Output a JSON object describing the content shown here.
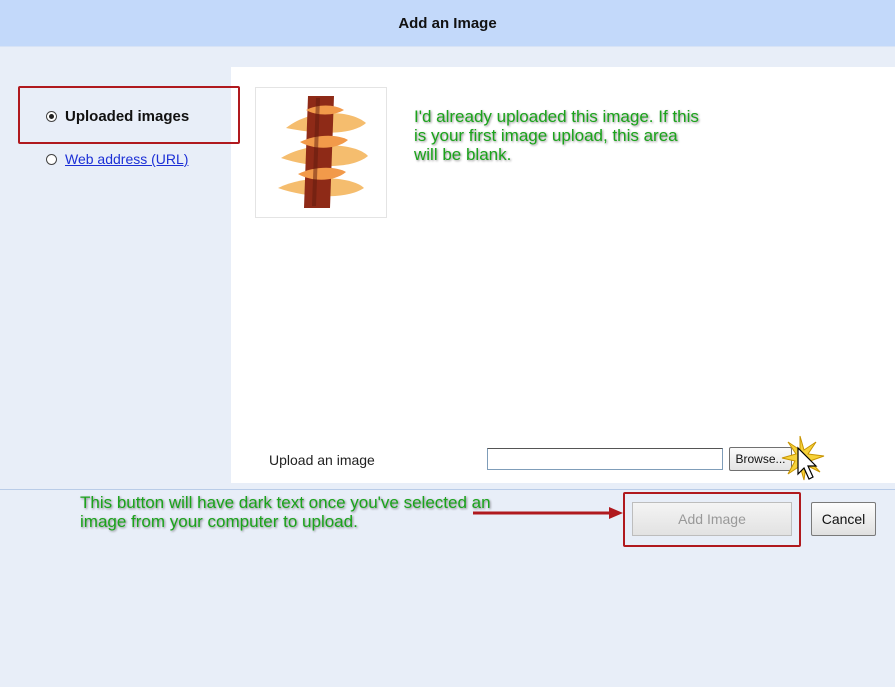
{
  "dialog": {
    "title": "Add an Image"
  },
  "sources": [
    {
      "label": "Uploaded images",
      "selected": true
    },
    {
      "label": "Web address (URL)",
      "selected": false
    }
  ],
  "annotations": {
    "already_uploaded": "I'd already uploaded this image.  If this is your first image upload, this area will be blank.",
    "dark_text_note": "This button will have dark text once you've selected an image from your computer to upload."
  },
  "upload": {
    "label": "Upload an image",
    "file_value": "",
    "browse_label": "Browse..."
  },
  "buttons": {
    "add_image": "Add Image",
    "add_image_enabled": false,
    "cancel": "Cancel"
  },
  "colors": {
    "header": "#c3d9fa",
    "annotation_text": "#1aa31a",
    "highlight": "#b0191e",
    "link": "#1b2fd6"
  }
}
